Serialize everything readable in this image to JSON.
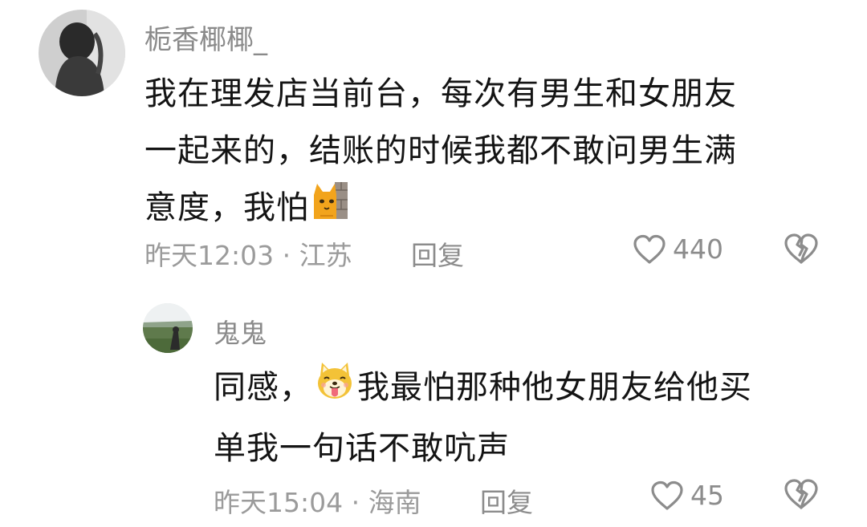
{
  "comments": [
    {
      "avatar_icon": "user-avatar",
      "username": "栀香椰椰_",
      "text_line1": "我在理发店当前台，每次有男生和女朋友",
      "text_line2": "一起来的，结账的时候我都不敢问男生满",
      "text_line3": "意度，我怕",
      "emoji_icon": "cat-peeking-wall-emoji",
      "timestamp_location": "昨天12:03 · 江苏",
      "reply_label": "回复",
      "like_count": "440",
      "like_icon": "heart-outline-icon",
      "dislike_icon": "broken-heart-icon"
    },
    {
      "avatar_icon": "user-avatar",
      "username": "鬼鬼",
      "text_prefix": "同感，",
      "emoji_icon": "shiba-dog-tongue-emoji",
      "text_suffix": "我最怕那种他女朋友给他买",
      "text_line2": "单我一句话不敢吭声",
      "timestamp_location": "昨天15:04 · 海南",
      "reply_label": "回复",
      "like_count": "45",
      "like_icon": "heart-outline-icon",
      "dislike_icon": "broken-heart-icon"
    }
  ],
  "colors": {
    "background": "#ffffff",
    "username": "#8a8a8a",
    "body_text": "#141414",
    "meta_text": "#9b9b9b",
    "icon_gray": "#8c8c8c"
  }
}
